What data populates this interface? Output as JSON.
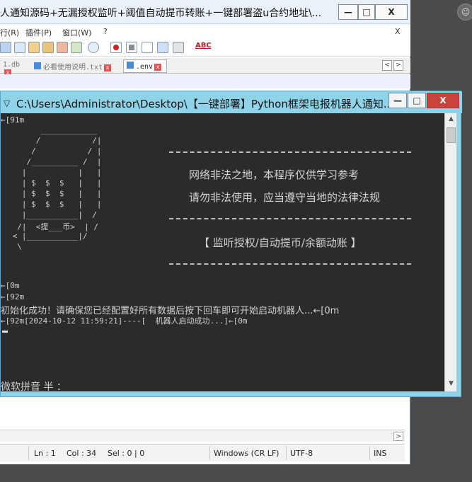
{
  "editor": {
    "title": "人通知源码+无漏授权监听+阈值自动提币转账+一键部署盗u合约地址\\...",
    "menu": [
      "行(R)",
      "插件(P)",
      "窗口(W)",
      "?"
    ],
    "menu_close": "X",
    "tabs": [
      {
        "label": "1.db",
        "active": false
      },
      {
        "label": "必看使用说明.txt",
        "active": false
      },
      {
        "label": ".env",
        "active": true
      }
    ],
    "nav_prev": "<",
    "nav_next": ">",
    "toolbar_abc": "ABC",
    "hscroll_arrow": ">",
    "status": {
      "line": "Ln : 1",
      "col": "Col : 34",
      "sel": "Sel : 0 | 0",
      "eol": "Windows (CR LF)",
      "encoding": "UTF-8",
      "mode": "INS"
    }
  },
  "console": {
    "title": "C:\\Users\\Administrator\\Desktop\\【一键部署】Python框架电报机器人通知...",
    "lines": {
      "l1": "←[91m",
      "art": [
        "       ____________",
        "      /           /|",
        "     /           / |",
        "    /__________ /  |",
        "   |           |   |",
        "   | $  $  $   |   |",
        "   | $  $  $   |   |",
        "   | $  $  $   |   |",
        "   |___________|  /",
        "  /|  <提___币>  | /",
        " < |___________|/",
        "  \\"
      ],
      "l_reset": "←[0m",
      "l_green": "←[92m",
      "init": "初始化成功！请确保您已经配置好所有数据后按下回车即可开始启动机器人...←[0m",
      "started": "←[92m[2024-10-12 11:59:21]----[  机器人启动成功...]←[0m",
      "ime": "微软拼音 半 ："
    },
    "notice": {
      "line1": "网络非法之地，本程序仅供学习参考",
      "line2": "请勿非法使用，应当遵守当地的法律法规",
      "features": "【 监听授权/自动提币/余额动账 】"
    },
    "buttons": {
      "minimize": "—",
      "maximize": "□",
      "close": "X"
    }
  },
  "editor_buttons": {
    "minimize": "—",
    "maximize": "□",
    "close": "X"
  },
  "colors": {
    "console_bg": "#2b2b2b",
    "console_frame": "#8fd3e9",
    "close_red": "#c9433a"
  }
}
